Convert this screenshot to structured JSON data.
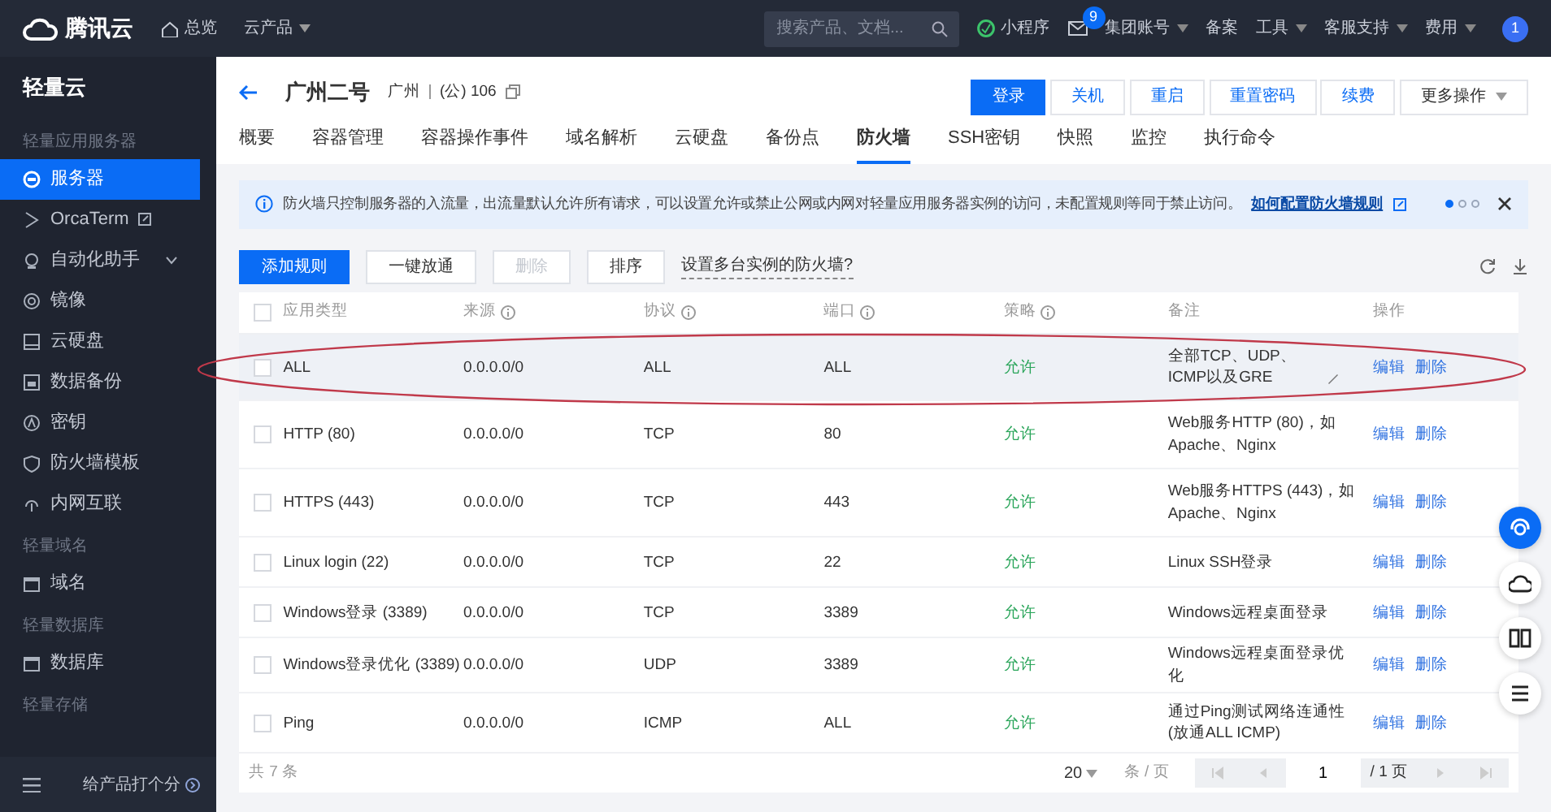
{
  "topbar": {
    "brand": "腾讯云",
    "home": "总览",
    "products": {
      "label": "云产品",
      "caret": true
    },
    "search": {
      "placeholder": "搜索产品、文档..."
    },
    "mini_program": "小程序",
    "mail_badge": "9",
    "menus": [
      {
        "label": "集团账号",
        "caret": true
      },
      {
        "label": "备案",
        "caret": false
      },
      {
        "label": "工具",
        "caret": true
      },
      {
        "label": "客服支持",
        "caret": true
      },
      {
        "label": "费用",
        "caret": true
      }
    ],
    "avatar": "1"
  },
  "sidebar": {
    "title": "轻量云",
    "sections": [
      {
        "heading": "轻量应用服务器",
        "items": [
          {
            "label": "服务器",
            "selected": true
          },
          {
            "label": "OrcaTerm",
            "selected": false,
            "external": true
          },
          {
            "label": "自动化助手",
            "selected": false,
            "expandable": true
          },
          {
            "label": "镜像",
            "selected": false
          },
          {
            "label": "云硬盘",
            "selected": false
          },
          {
            "label": "数据备份",
            "selected": false
          },
          {
            "label": "密钥",
            "selected": false
          },
          {
            "label": "防火墙模板",
            "selected": false
          },
          {
            "label": "内网互联",
            "selected": false
          }
        ]
      },
      {
        "heading": "轻量域名",
        "items": [
          {
            "label": "域名",
            "selected": false
          }
        ]
      },
      {
        "heading": "轻量数据库",
        "items": [
          {
            "label": "数据库",
            "selected": false
          }
        ]
      },
      {
        "heading": "轻量存储"
      }
    ],
    "rate": "给产品打个分"
  },
  "header": {
    "title": "广州二号",
    "region": "广州",
    "ip": "(公) 106",
    "buttons": [
      {
        "label": "登录",
        "primary": true
      },
      {
        "label": "关机",
        "primary": false
      },
      {
        "label": "重启",
        "primary": false
      },
      {
        "label": "重置密码",
        "primary": false
      },
      {
        "label": "续费",
        "primary": false
      },
      {
        "label": "更多操作",
        "primary": false,
        "caret": true
      }
    ]
  },
  "tabs": [
    {
      "label": "概要",
      "selected": false
    },
    {
      "label": "容器管理",
      "selected": false
    },
    {
      "label": "容器操作事件",
      "selected": false
    },
    {
      "label": "域名解析",
      "selected": false
    },
    {
      "label": "云硬盘",
      "selected": false
    },
    {
      "label": "备份点",
      "selected": false
    },
    {
      "label": "防火墙",
      "selected": true
    },
    {
      "label": "SSH密钥",
      "selected": false
    },
    {
      "label": "快照",
      "selected": false
    },
    {
      "label": "监控",
      "selected": false
    },
    {
      "label": "执行命令",
      "selected": false
    }
  ],
  "notice": {
    "text": "防火墙只控制服务器的入流量，出流量默认允许所有请求，可以设置允许或禁止公网或内网对轻量应用服务器实例的访问，未配置规则等同于禁止访问。",
    "link": "如何配置防火墙规则",
    "dots": [
      {
        "selected": true
      },
      {
        "selected": false
      },
      {
        "selected": false
      }
    ]
  },
  "toolbar": {
    "buttons": [
      {
        "label": "添加规则",
        "primary": true,
        "disabled": false
      },
      {
        "label": "一键放通",
        "primary": false,
        "disabled": false
      },
      {
        "label": "删除",
        "primary": false,
        "disabled": true
      },
      {
        "label": "排序",
        "primary": false,
        "disabled": false
      }
    ],
    "help_link": "设置多台实例的防火墙?"
  },
  "table": {
    "select_all": {
      "checked": false
    },
    "columns": [
      {
        "label": "应用类型",
        "info": false
      },
      {
        "label": "来源",
        "info": true
      },
      {
        "label": "协议",
        "info": true
      },
      {
        "label": "端口",
        "info": true
      },
      {
        "label": "策略",
        "info": true
      },
      {
        "label": "备注",
        "info": false
      },
      {
        "label": "操作",
        "info": false
      }
    ],
    "rows": [
      {
        "checked": false,
        "type": "ALL",
        "source": "0.0.0.0/0",
        "protocol": "ALL",
        "port": "ALL",
        "policy": "允许",
        "remark": "全部TCP、UDP、ICMP以及GRE",
        "editable_remark": true,
        "hovered": true,
        "circled": true,
        "actions": [
          "编辑",
          "删除"
        ]
      },
      {
        "checked": false,
        "type": "HTTP (80)",
        "source": "0.0.0.0/0",
        "protocol": "TCP",
        "port": "80",
        "policy": "允许",
        "remark": "Web服务HTTP (80)，如Apache、Nginx",
        "editable_remark": false,
        "hovered": false,
        "circled": false,
        "actions": [
          "编辑",
          "删除"
        ]
      },
      {
        "checked": false,
        "type": "HTTPS (443)",
        "source": "0.0.0.0/0",
        "protocol": "TCP",
        "port": "443",
        "policy": "允许",
        "remark": "Web服务HTTPS (443)，如Apache、Nginx",
        "editable_remark": false,
        "hovered": false,
        "circled": false,
        "actions": [
          "编辑",
          "删除"
        ]
      },
      {
        "checked": false,
        "type": "Linux login (22)",
        "source": "0.0.0.0/0",
        "protocol": "TCP",
        "port": "22",
        "policy": "允许",
        "remark": "Linux SSH登录",
        "editable_remark": false,
        "hovered": false,
        "circled": false,
        "actions": [
          "编辑",
          "删除"
        ]
      },
      {
        "checked": false,
        "type": "Windows登录 (3389)",
        "source": "0.0.0.0/0",
        "protocol": "TCP",
        "port": "3389",
        "policy": "允许",
        "remark": "Windows远程桌面登录",
        "editable_remark": false,
        "hovered": false,
        "circled": false,
        "actions": [
          "编辑",
          "删除"
        ]
      },
      {
        "checked": false,
        "type": "Windows登录优化 (3389)",
        "source": "0.0.0.0/0",
        "protocol": "UDP",
        "port": "3389",
        "policy": "允许",
        "remark": "Windows远程桌面登录优化",
        "editable_remark": false,
        "hovered": false,
        "circled": false,
        "actions": [
          "编辑",
          "删除"
        ]
      },
      {
        "checked": false,
        "type": "Ping",
        "source": "0.0.0.0/0",
        "protocol": "ICMP",
        "port": "ALL",
        "policy": "允许",
        "remark": "通过Ping测试网络连通性(放通ALL ICMP)",
        "editable_remark": false,
        "hovered": false,
        "circled": false,
        "actions": [
          "编辑",
          "删除"
        ]
      }
    ],
    "total": "共 7 条",
    "page_size": "20",
    "per_page": "条 / 页",
    "page": "1",
    "pages": "/ 1 页"
  }
}
